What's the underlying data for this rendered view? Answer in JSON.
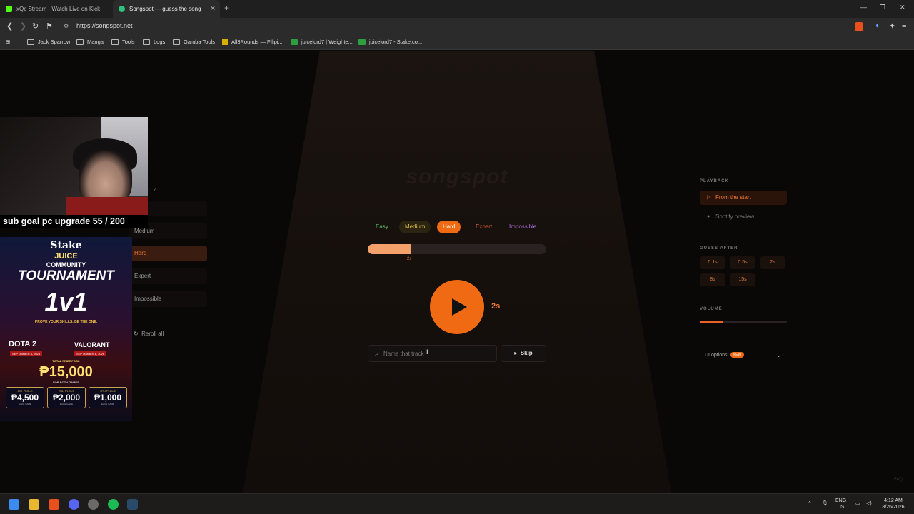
{
  "browser": {
    "tabs": [
      {
        "title": "xQc Stream - Watch Live on Kick",
        "active": false
      },
      {
        "title": "Songspot — guess the song",
        "active": true
      }
    ],
    "new_tab": "+",
    "url": "https://songspot.net",
    "bookmarks": [
      {
        "label": "Jack Sparrow",
        "icon": "folder-icon"
      },
      {
        "label": "Manga",
        "icon": "folder-icon"
      },
      {
        "label": "Tools",
        "icon": "folder-icon"
      },
      {
        "label": "Logs",
        "icon": "folder-icon"
      },
      {
        "label": "Gamba Tools",
        "icon": "folder-icon"
      },
      {
        "label": "All3Rounds — Filipi...",
        "icon": "site-icon"
      },
      {
        "label": "juicelord7 | Weighte...",
        "icon": "site-icon"
      },
      {
        "label": "juicelord7 - Stake.co...",
        "icon": "site-icon"
      }
    ]
  },
  "app": {
    "logo": "songspot",
    "difficulties": [
      {
        "label": "Easy",
        "color": "#5ec26a"
      },
      {
        "label": "Medium",
        "color": "#e6c24a"
      },
      {
        "label": "Hard",
        "color": "#ffffff",
        "selected": true
      },
      {
        "label": "Expert",
        "color": "#e0603a"
      },
      {
        "label": "Impossible",
        "color": "#b070e0"
      }
    ],
    "progress": {
      "fraction": 0.24,
      "marker": "2s"
    },
    "play": {
      "duration": "2s"
    },
    "search": {
      "placeholder": "Name that track"
    },
    "skip_label": "Skip"
  },
  "left_panel": {
    "header_fragment": "LTY",
    "items": [
      {
        "label": "Medium"
      },
      {
        "label": "Hard",
        "selected": true
      },
      {
        "label": "Expert"
      },
      {
        "label": "Impossible"
      }
    ],
    "reroll": "Reroll all"
  },
  "right_panel": {
    "playback_header": "PLAYBACK",
    "playback_options": [
      {
        "label": "From the start",
        "selected": true
      },
      {
        "label": "Spotify preview"
      }
    ],
    "guess_header": "GUESS AFTER",
    "guess_options": [
      "0.1s",
      "0.5s",
      "2s",
      "8s",
      "15s"
    ],
    "volume_header": "VOLUME",
    "volume_level": 0.27,
    "ui_options": "UI options",
    "ui_badge": "NEW",
    "faq": "FAQ"
  },
  "overlay": {
    "subgoal": "sub goal pc upgrade 55 / 200",
    "poster": {
      "brand": "Stake",
      "sub": "JUICE",
      "community": "COMMUNITY",
      "tournament": "TOURNAMENT",
      "format": "1v1",
      "tagline": "PROVE YOUR SKILLS. BE THE ONE.",
      "game1": "DOTA 2",
      "game2": "VALORANT",
      "date1": "SEPTEMBER 4, 2026",
      "date2": "SEPTEMBER 8, 2026",
      "pool_label": "TOTAL PRIZE POOL",
      "pool": "₱15,000",
      "pool_note": "FOR BOTH GAMES",
      "prizes": [
        {
          "place": "1ST PLACE",
          "amount": "₱4,500",
          "note": "EACH GAME"
        },
        {
          "place": "2ND PLACE",
          "amount": "₱2,000",
          "note": "EACH GAME"
        },
        {
          "place": "3RD PLACE",
          "amount": "₱1,000",
          "note": "EACH GAME"
        }
      ]
    }
  },
  "taskbar": {
    "lang_top": "ENG",
    "lang_bottom": "US",
    "time": "4:12 AM",
    "date": "8/26/2026"
  }
}
